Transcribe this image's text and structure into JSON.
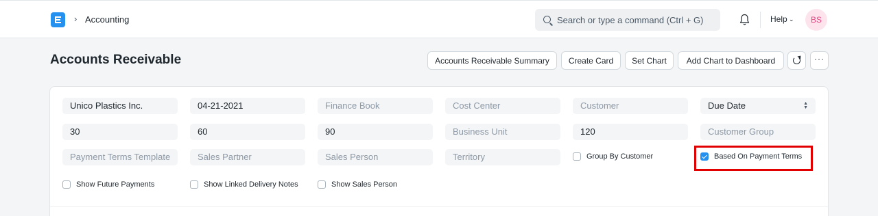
{
  "navbar": {
    "breadcrumb": "Accounting",
    "search_placeholder": "Search or type a command (Ctrl + G)",
    "help_label": "Help",
    "avatar_initials": "BS"
  },
  "page": {
    "title": "Accounts Receivable",
    "actions": {
      "summary": "Accounts Receivable Summary",
      "create_card": "Create Card",
      "set_chart": "Set Chart",
      "add_chart": "Add Chart to Dashboard"
    }
  },
  "filters": {
    "company": "Unico Plastics Inc.",
    "report_date": "04-21-2021",
    "finance_book": "Finance Book",
    "cost_center": "Cost Center",
    "customer": "Customer",
    "ageing_based_on": "Due Date",
    "range1": "30",
    "range2": "60",
    "range3": "90",
    "business_unit": "Business Unit",
    "range4": "120",
    "customer_group": "Customer Group",
    "payment_terms_template": "Payment Terms Template",
    "sales_partner": "Sales Partner",
    "sales_person": "Sales Person",
    "territory": "Territory"
  },
  "checkboxes": {
    "group_by_customer": {
      "label": "Group By Customer",
      "checked": false
    },
    "based_on_payment_terms": {
      "label": "Based On Payment Terms",
      "checked": true
    },
    "show_future_payments": {
      "label": "Show Future Payments",
      "checked": false
    },
    "show_linked_delivery_notes": {
      "label": "Show Linked Delivery Notes",
      "checked": false
    },
    "show_sales_person": {
      "label": "Show Sales Person",
      "checked": false
    }
  },
  "colors": {
    "accent": "#2490ef",
    "highlight": "#e20000",
    "avatar_bg": "#fde4ec",
    "avatar_text": "#e54785"
  }
}
